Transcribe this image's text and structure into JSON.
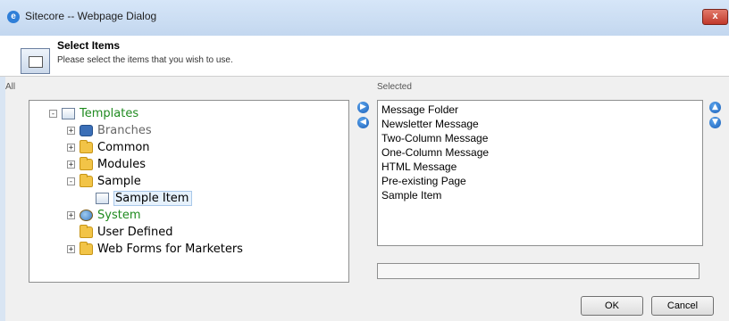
{
  "window": {
    "title": "Sitecore -- Webpage Dialog",
    "close_label": "x"
  },
  "header": {
    "title": "Select Items",
    "subtitle": "Please select the items that you wish to use."
  },
  "labels": {
    "all": "All",
    "selected": "Selected"
  },
  "tree": {
    "root": {
      "label": "Templates",
      "expander": "-",
      "icon": "template-doc-icon",
      "color": "#1f8a1f"
    },
    "children": [
      {
        "label": "Branches",
        "expander": "+",
        "icon": "branch-icon",
        "color": "#666666"
      },
      {
        "label": "Common",
        "expander": "+",
        "icon": "folder-icon"
      },
      {
        "label": "Modules",
        "expander": "+",
        "icon": "folder-icon"
      },
      {
        "label": "Sample",
        "expander": "-",
        "icon": "folder-icon",
        "children": [
          {
            "label": "Sample Item",
            "icon": "template-doc-icon",
            "selected": true
          }
        ]
      },
      {
        "label": "System",
        "expander": "+",
        "icon": "system-folder-icon",
        "color": "#1f8a1f"
      },
      {
        "label": "User Defined",
        "expander": "",
        "icon": "folder-icon"
      },
      {
        "label": "Web Forms for Marketers",
        "expander": "+",
        "icon": "folder-icon"
      }
    ]
  },
  "transfer": {
    "add_icon": "arrow-right-circle-icon",
    "remove_icon": "arrow-left-circle-icon"
  },
  "order": {
    "up_icon": "arrow-up-circle-icon",
    "down_icon": "arrow-down-circle-icon"
  },
  "selected_items": [
    "Message Folder",
    "Newsletter Message",
    "Two-Column Message",
    "One-Column Message",
    "HTML Message",
    "Pre-existing Page",
    "Sample Item"
  ],
  "buttons": {
    "ok": "OK",
    "cancel": "Cancel"
  },
  "colors": {
    "accent": "#2f7fd8",
    "tree_green": "#1f8a1f",
    "dialog_bg": "#f0f0f0",
    "frame": "#cfe0f3"
  }
}
